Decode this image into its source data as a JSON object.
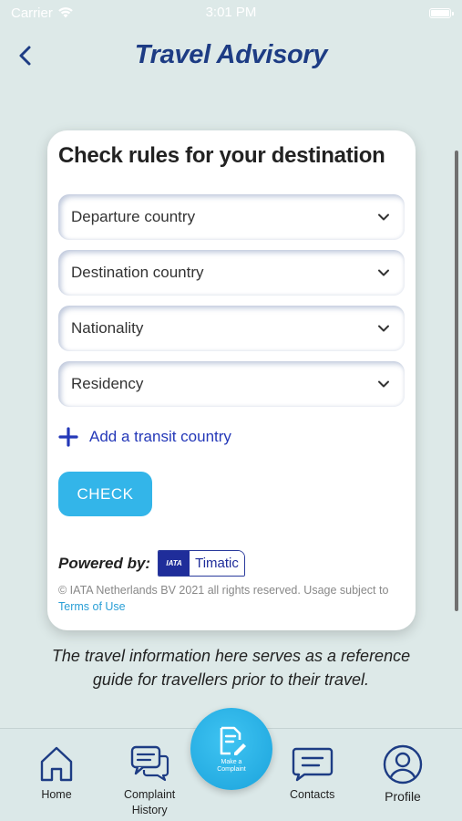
{
  "status_bar": {
    "carrier": "Carrier",
    "time": "3:01 PM"
  },
  "header": {
    "title": "Travel Advisory"
  },
  "card": {
    "title": "Check rules for your destination",
    "dropdowns": [
      {
        "label": "Departure country"
      },
      {
        "label": "Destination country"
      },
      {
        "label": "Nationality"
      },
      {
        "label": "Residency"
      }
    ],
    "add_transit_label": "Add a transit country",
    "check_label": "CHECK",
    "powered_by_label": "Powered by:",
    "iata_label": "IATA",
    "timatic_label": "Timatic",
    "copyright": "© IATA Netherlands BV 2021 all rights reserved. Usage subject to ",
    "terms_label": "Terms of Use"
  },
  "disclaimer": {
    "line1": "The travel information here serves as a reference",
    "line2": "guide for travellers prior to their travel."
  },
  "tabbar": {
    "home": "Home",
    "complaint_history_1": "Complaint",
    "complaint_history_2": "History",
    "make_complaint_1": "Make a",
    "make_complaint_2": "Complaint",
    "contacts": "Contacts",
    "profile": "Profile"
  },
  "colors": {
    "accent": "#33b5e9",
    "title": "#1d3c84",
    "link": "#2438b8",
    "background": "#dde9e8"
  }
}
